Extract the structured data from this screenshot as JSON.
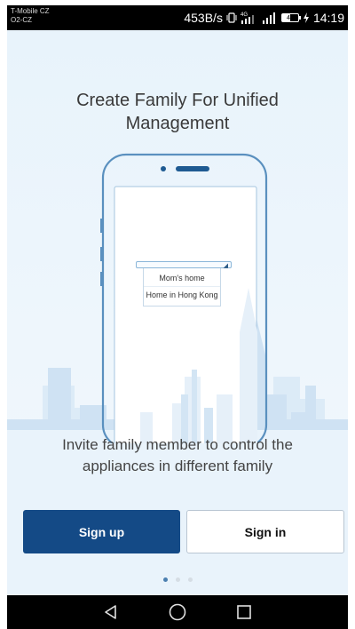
{
  "status_bar": {
    "carrier_line1": "T-Mobile CZ",
    "carrier_line2": "O2-CZ",
    "network_speed": "453B/s",
    "network_type": "4G",
    "battery_level": "49",
    "time": "14:19",
    "icons": [
      "vibrate-icon",
      "signal-4g-icon",
      "signal-icon",
      "battery-icon",
      "charging-icon"
    ]
  },
  "onboarding": {
    "title_line1": "Create Family For Unified",
    "title_line2": "Management",
    "dropdown_items": [
      "Mom's home",
      "Home in Hong Kong"
    ],
    "subtitle_line1": "Invite family member to control the",
    "subtitle_line2": "appliances in different family",
    "page_count": 3,
    "active_page": 1
  },
  "actions": {
    "signup_label": "Sign up",
    "signin_label": "Sign in"
  },
  "nav_bar": {
    "icons": [
      "back-icon",
      "home-icon",
      "recents-icon"
    ]
  },
  "colors": {
    "primary": "#144a86",
    "background": "#e8f3fb",
    "skyline": "#d3e5f4",
    "active_dot": "#4b7fb0"
  }
}
